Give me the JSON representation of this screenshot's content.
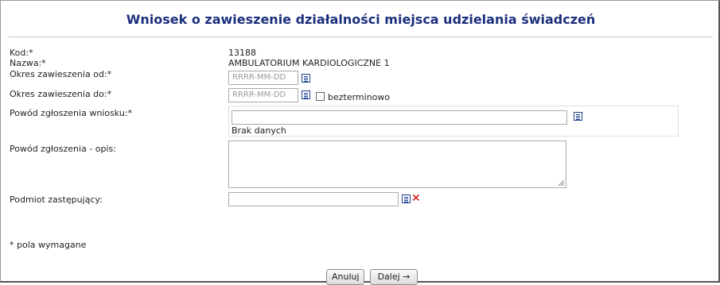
{
  "title": "Wniosek o zawieszenie działalności miejsca udzielania świadczeń",
  "fields": {
    "kod_label": "Kod:*",
    "kod_value": "13188",
    "nazwa_label": "Nazwa:*",
    "nazwa_value": "AMBULATORIUM KARDIOLOGICZNE 1",
    "okres_od_label": "Okres zawieszenia od:*",
    "okres_od_placeholder": "RRRR-MM-DD",
    "okres_do_label": "Okres zawieszenia do:*",
    "okres_do_placeholder": "RRRR-MM-DD",
    "bezterminowo_label": "bezterminowo",
    "powod_label": "Powód zgłoszenia wniosku:*",
    "powod_value": "",
    "powod_empty": "Brak danych",
    "opis_label": "Powód zgłoszenia - opis:",
    "opis_value": "",
    "podmiot_label": "Podmiot zastępujący:",
    "podmiot_value": ""
  },
  "required_note": "* pola wymagane",
  "buttons": {
    "cancel": "Anuluj",
    "next": "Dalej →"
  },
  "colors": {
    "title": "#1b2f7c",
    "icon": "#1e3f8f",
    "clear": "#d40000"
  },
  "icons": {
    "list": "list-icon",
    "clear": "x-icon"
  }
}
